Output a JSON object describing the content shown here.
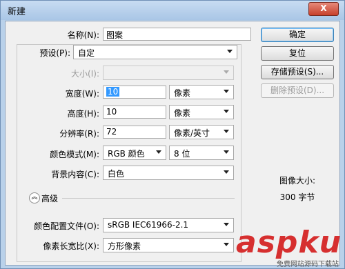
{
  "window": {
    "title": "新建",
    "close_label": "X"
  },
  "form": {
    "name_label": "名称(N):",
    "name_value": "图案",
    "preset_label": "预设(P):",
    "preset_value": "自定",
    "size_label": "大小(I):",
    "size_value": "",
    "width_label": "宽度(W):",
    "width_value": "10",
    "width_unit": "像素",
    "height_label": "高度(H):",
    "height_value": "10",
    "height_unit": "像素",
    "resolution_label": "分辨率(R):",
    "resolution_value": "72",
    "resolution_unit": "像素/英寸",
    "color_mode_label": "颜色模式(M):",
    "color_mode_value": "RGB 颜色",
    "bit_depth_value": "8 位",
    "background_label": "背景内容(C):",
    "background_value": "白色",
    "advanced_label": "高级",
    "color_profile_label": "颜色配置文件(O):",
    "color_profile_value": "sRGB IEC61966-2.1",
    "pixel_aspect_label": "像素长宽比(X):",
    "pixel_aspect_value": "方形像素"
  },
  "buttons": {
    "ok": "确定",
    "reset": "复位",
    "save_preset": "存储预设(S)...",
    "delete_preset": "删除预设(D)..."
  },
  "image_size": {
    "label": "图像大小:",
    "value": "300 字节"
  },
  "watermark": {
    "brand": "aspku",
    "tagline": "免费网站源码下载站"
  }
}
